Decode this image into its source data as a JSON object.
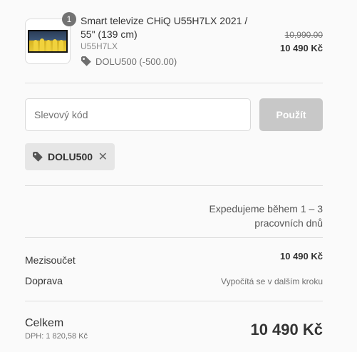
{
  "product": {
    "quantity": "1",
    "title": "Smart televize CHiQ U55H7LX 2021 / 55\" (139 cm)",
    "sku": "U55H7LX",
    "discount_line": "DOLU500 (-500.00)",
    "price_original": "10,990.00",
    "price_current": "10 490 Kč"
  },
  "discount": {
    "placeholder": "Slevový kód",
    "value": "",
    "apply_label": "Použít",
    "applied_code": "DOLU500"
  },
  "shipping_note": "Expedujeme během 1 – 3 pracovních dnů",
  "summary": {
    "subtotal_label": "Mezisoučet",
    "subtotal_value": "10 490 Kč",
    "shipping_label": "Doprava",
    "shipping_value": "Vypočítá se v dalším kroku",
    "total_label": "Celkem",
    "vat_text": "DPH: 1 820,58 Kč",
    "total_value": "10 490 Kč"
  },
  "icons": {
    "tag": "tag-icon",
    "close": "close-icon"
  },
  "colors": {
    "background": "#fafafa",
    "button_disabled": "#c8c8c8",
    "chip_bg": "#e6e6e6",
    "badge": "#737373"
  }
}
